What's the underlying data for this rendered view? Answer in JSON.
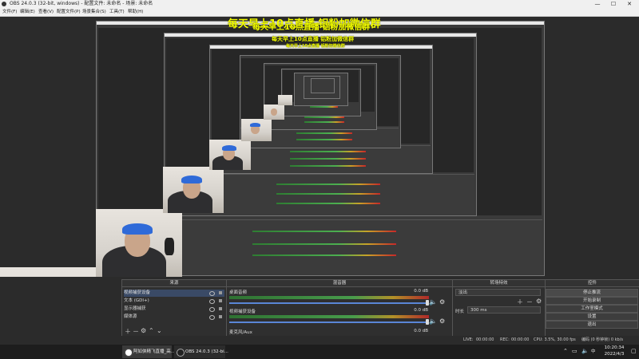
{
  "window": {
    "title": "OBS 24.0.3 (32-bit, windows) - 配置文件: 未命名 - 场景: 未命名",
    "minimize": "—",
    "maximize": "☐",
    "close": "✕"
  },
  "menu": [
    "文件(F)",
    "编辑(E)",
    "查看(V)",
    "配置文件(P)",
    "场景集合(S)",
    "工具(T)",
    "帮助(H)"
  ],
  "banner": {
    "text": "每天早上10点直播    铝粉加微信群",
    "color": "#f4ff00"
  },
  "docks": {
    "sources_title": "来源",
    "mixer_title": "混音器",
    "transitions_title": "转场特效",
    "controls_title": "控件"
  },
  "sources": [
    {
      "label": "视频捕获设备"
    },
    {
      "label": "文本 (GDI+)"
    },
    {
      "label": "显示器捕获"
    },
    {
      "label": "媒体源"
    }
  ],
  "mixer": [
    {
      "name": "桌面音频",
      "db": "0.0 dB"
    },
    {
      "name": "视频捕获设备",
      "db": "0.0 dB"
    },
    {
      "name": "麦克风/Aux",
      "db": "0.0 dB"
    }
  ],
  "transitions": {
    "selected": "淡出",
    "duration_label": "时长",
    "duration_value": "300 ms"
  },
  "controls": {
    "buttons": [
      "停止推流",
      "开始录制",
      "工作室模式",
      "设置",
      "退出"
    ]
  },
  "status": {
    "live_label": "LIVE:",
    "live_time": "00:00:00",
    "rec_label": "REC:",
    "rec_time": "00:00:00",
    "cpu": "CPU: 3.5%, 30.00 fps",
    "kbps": "编码  (0 秒钟帧) 0 kb/s"
  },
  "taskbar": {
    "tasks": [
      "阿如侠精飞直播_高...",
      "OBS 24.0.3 (32-bi..."
    ],
    "clock_time": "10:20:34",
    "clock_date": "2022/4/3",
    "lang": "中"
  },
  "colors": {
    "accent": "#5a86d6",
    "banner": "#f4ff00",
    "meter_green": "#4caf50"
  }
}
